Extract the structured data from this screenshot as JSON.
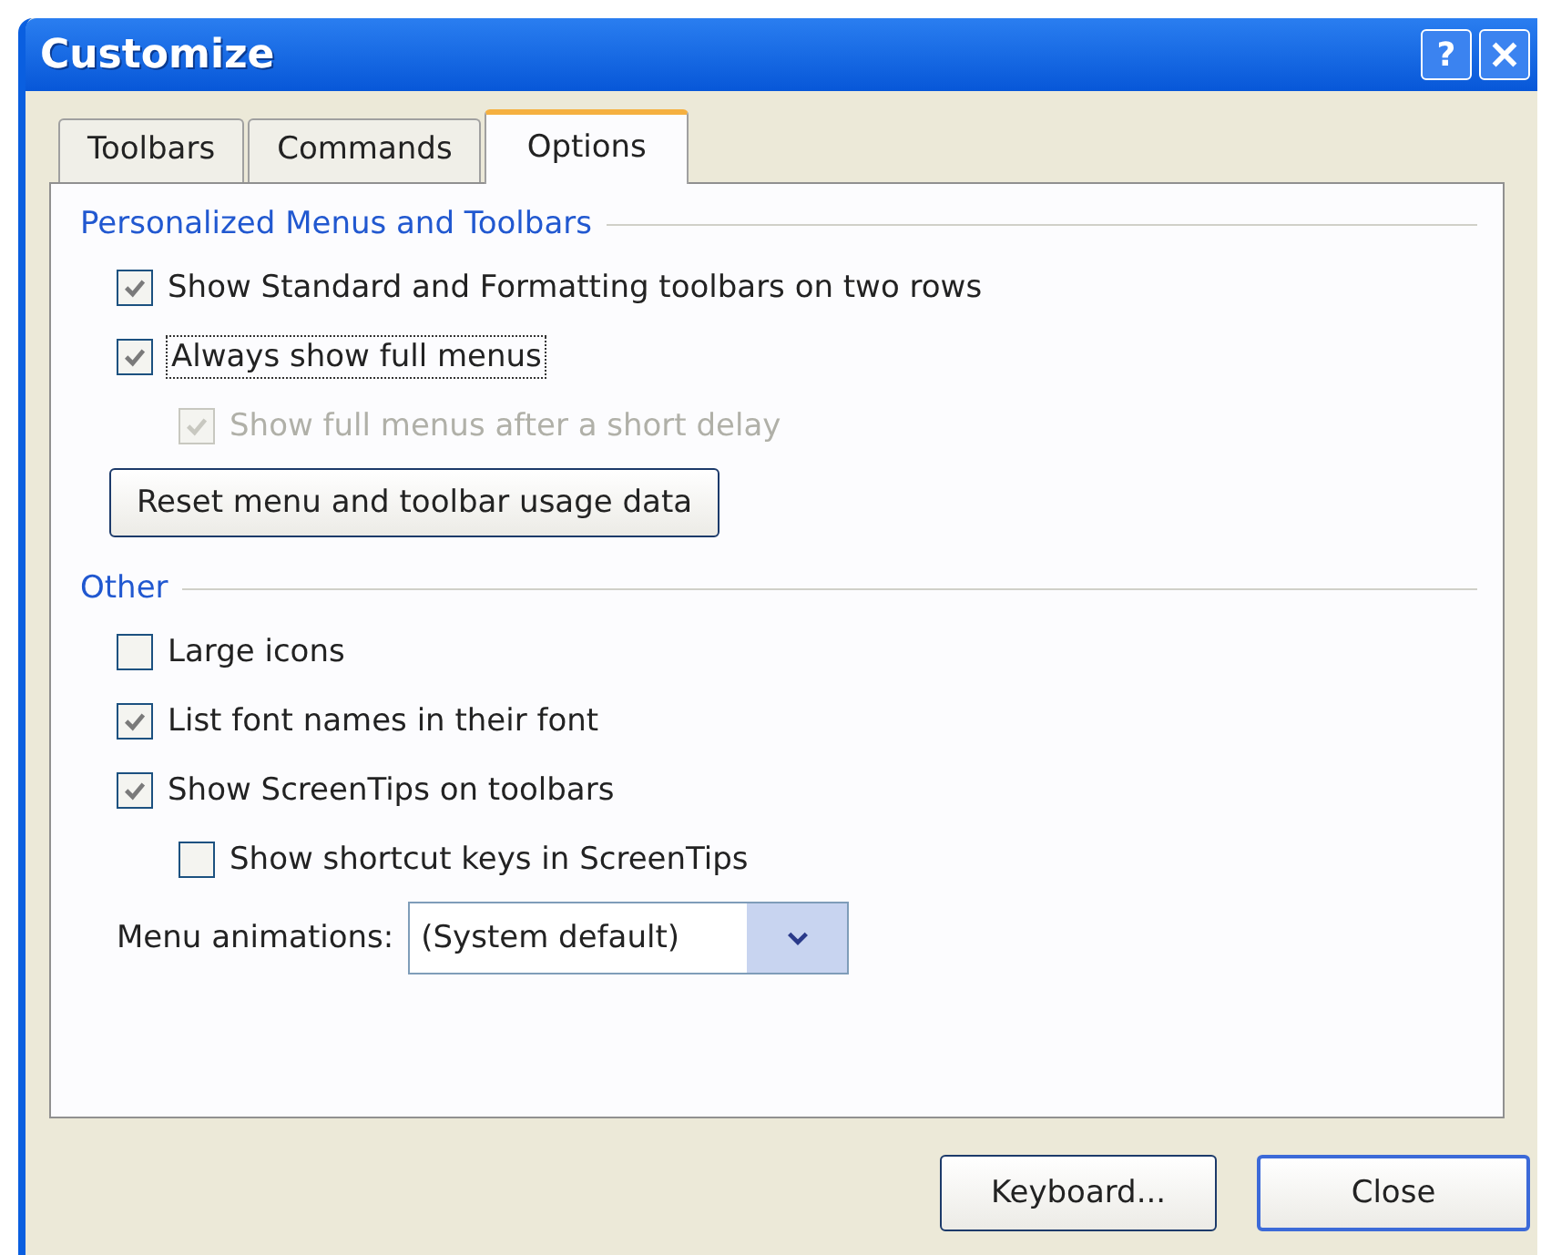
{
  "window": {
    "title": "Customize",
    "help_button": "?"
  },
  "tabs": [
    {
      "label": "Toolbars",
      "selected": false
    },
    {
      "label": "Commands",
      "selected": false
    },
    {
      "label": "Options",
      "selected": true
    }
  ],
  "sections": [
    {
      "title": "Personalized Menus and Toolbars",
      "items": [
        {
          "kind": "checkbox",
          "label": "Show Standard and Formatting toolbars on two rows",
          "checked": true,
          "disabled": false,
          "focused": false
        },
        {
          "kind": "checkbox",
          "label": "Always show full menus",
          "checked": true,
          "disabled": false,
          "focused": true,
          "children": [
            {
              "kind": "checkbox",
              "label": "Show full menus after a short delay",
              "checked": true,
              "disabled": true,
              "focused": false
            }
          ]
        },
        {
          "kind": "button",
          "label": "Reset menu and toolbar usage data"
        }
      ]
    },
    {
      "title": "Other",
      "items": [
        {
          "kind": "checkbox",
          "label": "Large icons",
          "checked": false,
          "disabled": false,
          "focused": false
        },
        {
          "kind": "checkbox",
          "label": "List font names in their font",
          "checked": true,
          "disabled": false,
          "focused": false
        },
        {
          "kind": "checkbox",
          "label": "Show ScreenTips on toolbars",
          "checked": true,
          "disabled": false,
          "focused": false,
          "children": [
            {
              "kind": "checkbox",
              "label": "Show shortcut keys in ScreenTips",
              "checked": false,
              "disabled": false,
              "focused": false
            }
          ]
        },
        {
          "kind": "select",
          "label": "Menu animations:",
          "value": "(System default)"
        }
      ]
    }
  ],
  "buttons": [
    {
      "label": "Keyboard...",
      "default": false
    },
    {
      "label": "Close",
      "default": true
    }
  ]
}
